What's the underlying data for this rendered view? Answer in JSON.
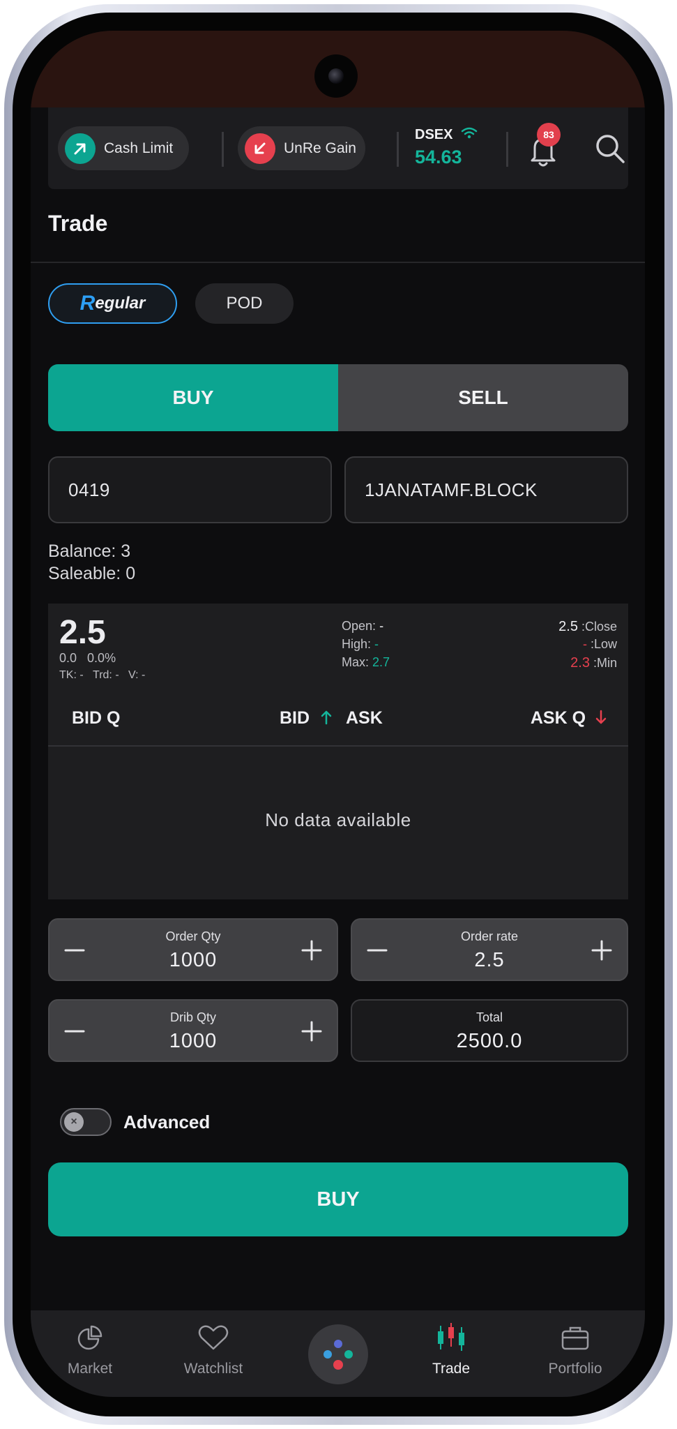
{
  "header": {
    "cash_limit_label": "Cash Limit",
    "unre_gain_label": "UnRe Gain",
    "index_name": "DSEX",
    "index_value": "54.63",
    "notification_count": "83"
  },
  "page": {
    "title": "Trade"
  },
  "order_type": {
    "regular_cap": "R",
    "regular_rest": "egular",
    "pod_label": "POD",
    "selected": "Regular"
  },
  "side": {
    "buy_label": "BUY",
    "sell_label": "SELL",
    "selected": "BUY"
  },
  "fields": {
    "account": "0419",
    "symbol": "1JANATAMF.BLOCK"
  },
  "holdings": {
    "balance": "Balance: 3",
    "saleable": "Saleable: 0"
  },
  "quote": {
    "last": "2.5",
    "change": "0.0",
    "change_pct": "0.0%",
    "tk": "TK: -",
    "trd": "Trd: -",
    "v": "V: -",
    "open_label": "Open:",
    "open_value": "-",
    "high_label": "High:",
    "high_value": "-",
    "max_label": "Max:",
    "max_value": "2.7",
    "close_value": "2.5",
    "close_label": ":Close",
    "low_value": "-",
    "low_label": ":Low",
    "min_value": "2.3",
    "min_label": ":Min"
  },
  "order_book": {
    "bid_q": "BID Q",
    "bid": "BID",
    "ask": "ASK",
    "ask_q": "ASK Q",
    "empty_message": "No data available"
  },
  "order_form": {
    "qty_label": "Order Qty",
    "qty_value": "1000",
    "rate_label": "Order rate",
    "rate_value": "2.5",
    "drip_label": "Drib Qty",
    "drip_value": "1000",
    "total_label": "Total",
    "total_value": "2500.0",
    "advanced_label": "Advanced",
    "advanced_on": false,
    "submit_label": "BUY"
  },
  "nav": {
    "items": [
      "Market",
      "Watchlist",
      "Trade",
      "Portfolio"
    ],
    "active": "Trade"
  },
  "colors": {
    "accent": "#0ca591",
    "negative": "#e6404e",
    "link": "#2d9ff5",
    "background": "#0d0d0f"
  }
}
